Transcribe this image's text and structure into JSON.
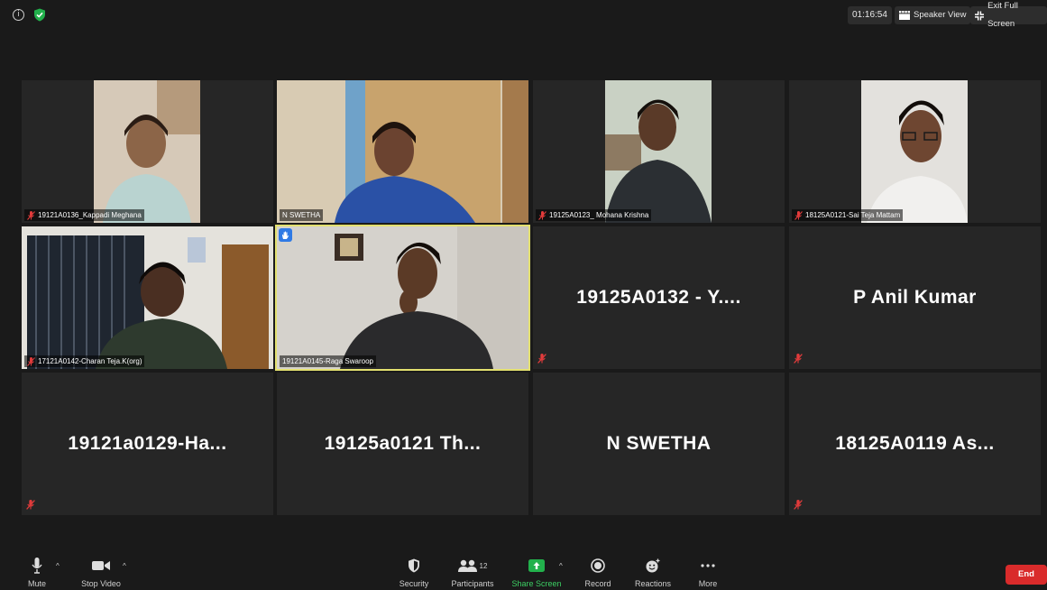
{
  "window": {
    "timer": "01:16:54",
    "speaker_view_label": "Speaker View",
    "exit_full_screen_label": "Exit Full Screen",
    "info_icon": "info-icon",
    "security_badge_icon": "shield-check-icon"
  },
  "tiles": [
    {
      "name": "19121A0136_Kappadi Meghana",
      "muted": true,
      "video": true
    },
    {
      "name": "N SWETHA",
      "muted": false,
      "video": true
    },
    {
      "name": "19125A0123_ Mohana Krishna",
      "muted": true,
      "video": true
    },
    {
      "name": "18125A0121-Sai Teja Mattam",
      "muted": true,
      "video": true
    },
    {
      "name": "17121A0142-Charan Teja.K(org)",
      "muted": true,
      "video": true
    },
    {
      "name": "19121A0145-Raga Swaroop",
      "muted": false,
      "video": true,
      "active_speaker": true,
      "hand_raised": true
    },
    {
      "name": "19125A0132 - Y....",
      "muted": true,
      "video": false
    },
    {
      "name": "P Anil Kumar",
      "muted": true,
      "video": false
    },
    {
      "name": "19121a0129-Ha...",
      "muted": true,
      "video": false
    },
    {
      "name": "19125a0121  Th...",
      "muted": false,
      "video": false
    },
    {
      "name": "N SWETHA",
      "muted": false,
      "video": false
    },
    {
      "name": "18125A0119  As...",
      "muted": true,
      "video": false
    }
  ],
  "toolbar": {
    "mute_label": "Mute",
    "stop_video_label": "Stop Video",
    "security_label": "Security",
    "participants_label": "Participants",
    "participants_count": "12",
    "share_screen_label": "Share Screen",
    "record_label": "Record",
    "reactions_label": "Reactions",
    "more_label": "More",
    "end_label": "End"
  },
  "colors": {
    "background": "#1a1a1a",
    "tile": "#262626",
    "active_speaker_border": "#e3e06f",
    "share_green": "#22b14c",
    "end_red": "#d92b2b",
    "mute_red": "#e23b3b"
  }
}
